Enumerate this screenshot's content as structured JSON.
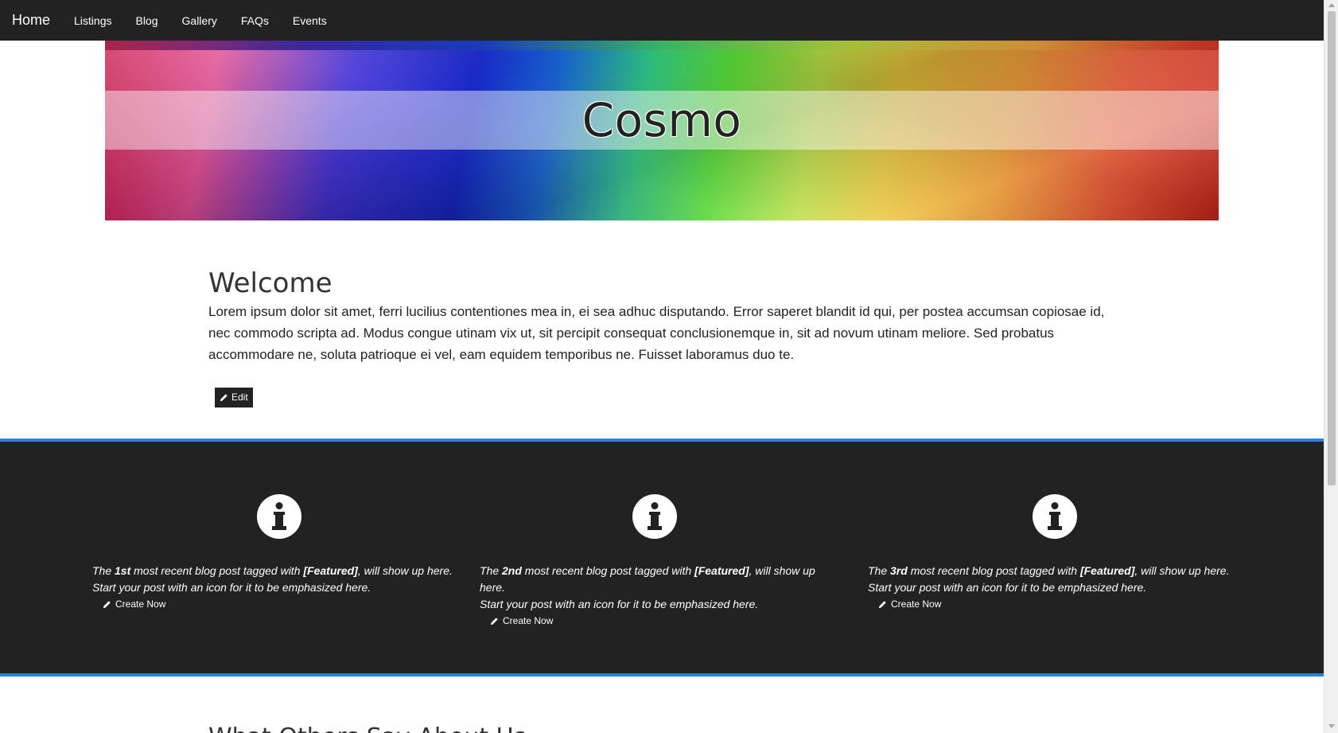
{
  "navbar": {
    "brand": "Home",
    "links": [
      "Listings",
      "Blog",
      "Gallery",
      "FAQs",
      "Events"
    ]
  },
  "banner": {
    "title": "Cosmo"
  },
  "welcome": {
    "heading": "Welcome",
    "body": "Lorem ipsum dolor sit amet, ferri lucilius contentiones mea in, ei sea adhuc disputando. Error saperet blandit id qui, per postea accumsan copiosae id, nec commodo scripta ad. Modus congue utinam vix ut, sit percipit consequat conclusionemque in, sit ad novum utinam meliore. Sed probatus accommodare ne, soluta patrioque ei vel, eam equidem temporibus ne. Fuisset laboramus duo te.",
    "edit_label": "Edit"
  },
  "featured": {
    "items": [
      {
        "text_the": "The ",
        "ordinal": "1st",
        "text_mid": " most recent blog post tagged with ",
        "tag": "[Featured]",
        "text_end": ", will show up here.",
        "line2": "Start your post with an icon for it to be emphasized here.",
        "create_label": "Create Now"
      },
      {
        "text_the": "The ",
        "ordinal": "2nd",
        "text_mid": " most recent blog post tagged with ",
        "tag": "[Featured]",
        "text_end": ", will show up here.",
        "line2": "Start your post with an icon for it to be emphasized here.",
        "create_label": "Create Now"
      },
      {
        "text_the": "The ",
        "ordinal": "3rd",
        "text_mid": " most recent blog post tagged with ",
        "tag": "[Featured]",
        "text_end": ", will show up here.",
        "line2": "Start your post with an icon for it to be emphasized here.",
        "create_label": "Create Now"
      }
    ],
    "accent_color": "#2780e3",
    "icon": "info-icon"
  },
  "next_section": {
    "heading": "What Others Say About Us"
  }
}
